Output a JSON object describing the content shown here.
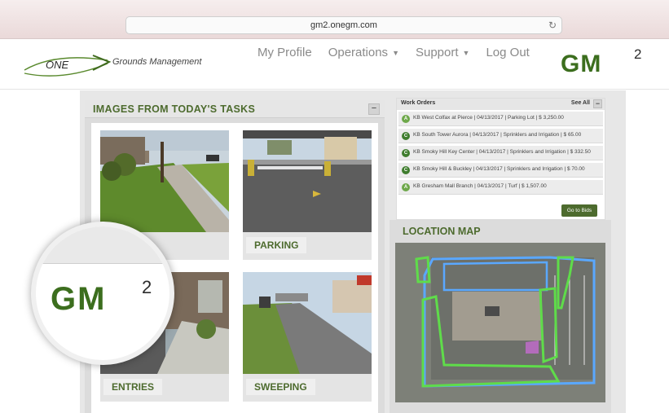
{
  "browser": {
    "url": "gm2.onegm.com",
    "reload_icon": "reload-icon"
  },
  "header": {
    "logo_word": "ONE",
    "logo_tagline": "Grounds Management",
    "nav": [
      {
        "label": "My Profile",
        "has_dropdown": false
      },
      {
        "label": "Operations",
        "has_dropdown": true
      },
      {
        "label": "Support",
        "has_dropdown": true
      },
      {
        "label": "Log Out",
        "has_dropdown": false
      }
    ],
    "brand_logo": "GM",
    "brand_superscript": "2"
  },
  "images_panel": {
    "title": "IMAGES FROM TODAY'S TASKS",
    "collapse_label": "−",
    "tiles": [
      {
        "label": ""
      },
      {
        "label": "PARKING"
      },
      {
        "label": "ENTRIES"
      },
      {
        "label": "SWEEPING"
      }
    ]
  },
  "work_orders": {
    "title": "Work Orders",
    "see_all": "See All",
    "collapse_label": "−",
    "rows": [
      {
        "badge": "A",
        "text": "KB West Colfax at Pierce | 04/13/2017 | Parking Lot | $ 3,250.00"
      },
      {
        "badge": "C",
        "text": "KB South Tower Aurora | 04/13/2017 | Sprinklers and Irrigation | $ 65.00"
      },
      {
        "badge": "C",
        "text": "KB Smoky Hill Key Center | 04/13/2017 | Sprinklers and Irrigation | $ 332.50"
      },
      {
        "badge": "C",
        "text": "KB Smoky Hill & Buckley | 04/13/2017 | Sprinklers and Irrigation | $ 70.00"
      },
      {
        "badge": "A",
        "text": "KB Gresham Mall Branch | 04/13/2017 | Turf | $ 1,507.00"
      }
    ],
    "go_to_bids": "Go to Bids"
  },
  "location_map": {
    "title": "LOCATION MAP"
  },
  "magnifier": {
    "logo": "GM",
    "superscript": "2"
  },
  "colors": {
    "brand_green": "#4d6b2e",
    "badge_green": "#6ea84a",
    "map_blue": "#5aa8ff",
    "map_green": "#5fdc4a"
  }
}
